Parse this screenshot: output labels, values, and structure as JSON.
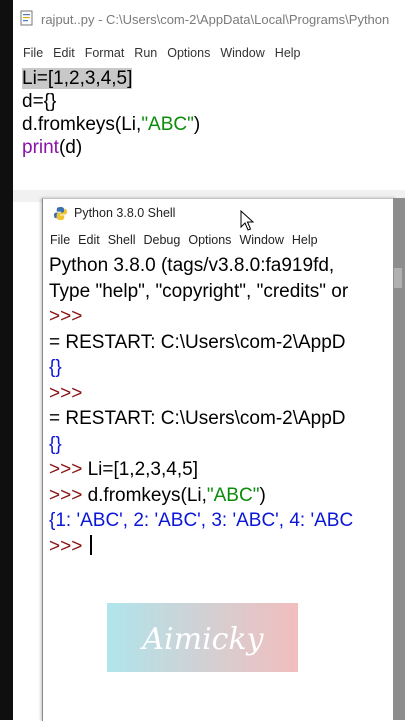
{
  "editor": {
    "title": "rajput..py - C:\\Users\\com-2\\AppData\\Local\\Programs\\Python",
    "menu": [
      "File",
      "Edit",
      "Format",
      "Run",
      "Options",
      "Window",
      "Help"
    ],
    "code": {
      "line1_sel": "Li=[1,2,3,4,5]",
      "line1_rest": "L",
      "line2": "d={}",
      "line3_a": "d.fromkeys(Li,",
      "line3_str": "\"ABC\"",
      "line3_b": ")",
      "line4_kw": "print",
      "line4_rest": "(d)"
    }
  },
  "shell": {
    "title": "Python 3.8.0 Shell",
    "menu": [
      "File",
      "Edit",
      "Shell",
      "Debug",
      "Options",
      "Window",
      "Help"
    ],
    "lines": {
      "banner": "Python 3.8.0 (tags/v3.8.0:fa919fd,",
      "help": "Type \"help\", \"copyright\", \"credits\" or",
      "prompt": ">>>",
      "restart1": "= RESTART: C:\\Users\\com-2\\AppD",
      "result_empty1": "{}",
      "restart2": "= RESTART: C:\\Users\\com-2\\AppD",
      "result_empty2": "{}",
      "cmd1_prompt": ">>> ",
      "cmd1": "Li=[1,2,3,4,5]",
      "cmd2_prompt": ">>> ",
      "cmd2_a": "d.fromkeys(Li,",
      "cmd2_str": "\"ABC\"",
      "cmd2_b": ")",
      "result_dict": "{1: 'ABC', 2: 'ABC', 3: 'ABC', 4: 'ABC",
      "final_prompt": ">>> "
    }
  },
  "watermark": {
    "text": "Aimicky"
  },
  "colors": {
    "string_green": "#0b8c0b",
    "keyword_purple": "#8b12a8",
    "prompt_red": "#8a1414",
    "output_blue": "#0b17d8"
  }
}
